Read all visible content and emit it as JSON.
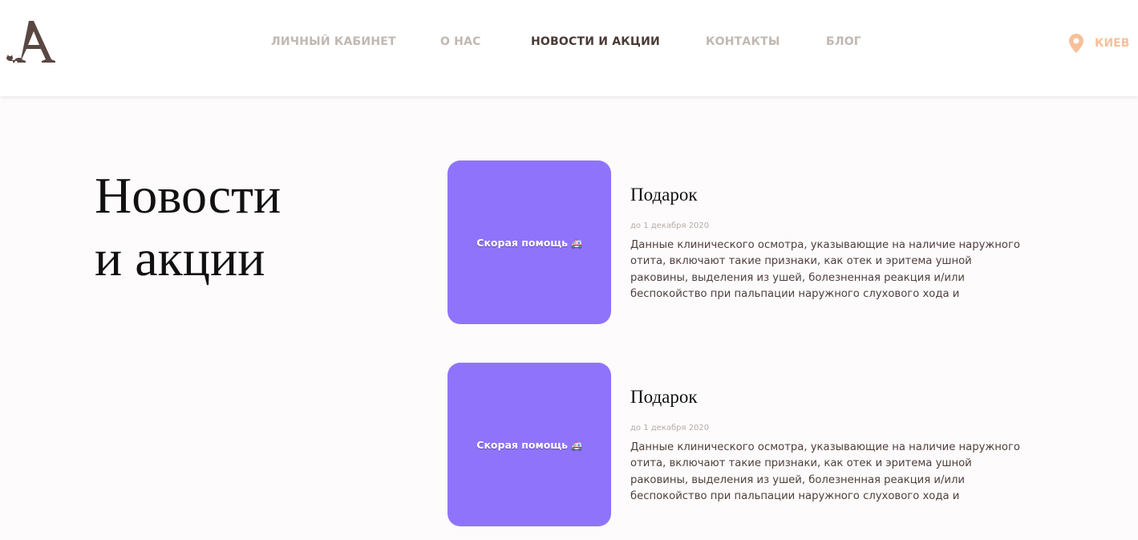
{
  "header": {
    "logo_letter": "A",
    "nav": [
      {
        "label": "ЛИЧНЫЙ КАБИНЕТ"
      },
      {
        "label": "О НАС"
      },
      {
        "label": "НОВОСТИ И АКЦИИ"
      },
      {
        "label": "КОНТАКТЫ"
      },
      {
        "label": "БЛОГ"
      }
    ],
    "active_nav": "НОВОСТИ И АКЦИИ",
    "city": "КИЕВ",
    "city_icon": "map-pin-icon"
  },
  "main": {
    "title_line1": "Новости",
    "title_line2": "и акции",
    "news": [
      {
        "image_text": "Скорая помощь",
        "title": "Подарок",
        "date": "до 1 декабря 2020",
        "text": "Данные клинического осмотра, указывающие на наличие наружного отита, включают такие признаки, как отек и эритема ушной раковины, выделения из ушей, болезненная реакция и/или беспокойство при пальпации наружного слухового хода и потряхивание головой после..."
      },
      {
        "image_text": "Скорая помощь",
        "title": "Подарок",
        "date": "до 1 декабря 2020",
        "text": "Данные клинического осмотра, указывающие на наличие наружного отита, включают такие признаки, как отек и эритема ушной раковины, выделения из ушей, болезненная реакция и/или беспокойство при пальпации наружного слухового хода и потряхивание головой после..."
      }
    ]
  },
  "colors": {
    "accent": "#f7c09a",
    "nav_inactive": "#c1b8b2",
    "nav_active": "#4a3a36",
    "card_bg": "#8f74fb",
    "brand_brown": "#5a4742"
  }
}
